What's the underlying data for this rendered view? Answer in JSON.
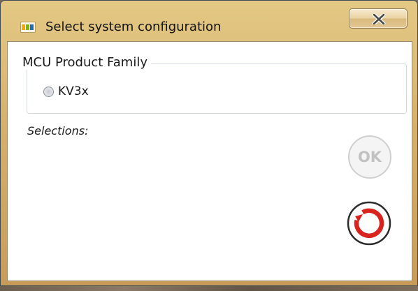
{
  "window": {
    "title": "Select system configuration",
    "icon": "nxp-logo-icon",
    "close_icon": "close-icon"
  },
  "group": {
    "legend": "MCU Product Family",
    "options": [
      {
        "label": "KV3x",
        "selected": false
      }
    ]
  },
  "selections": {
    "label": "Selections:"
  },
  "buttons": {
    "ok_label": "OK",
    "ok_enabled": false,
    "reset_icon": "reset-icon"
  },
  "colors": {
    "titlebar": "#d5b06a",
    "reset_red": "#d8231f",
    "ok_disabled": "#c2c2c2"
  }
}
